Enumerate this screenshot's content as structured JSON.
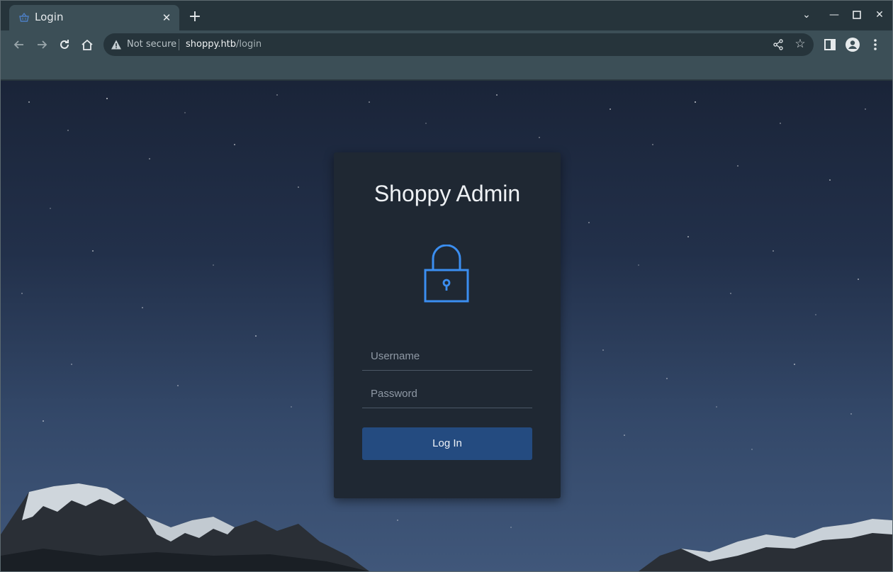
{
  "browser": {
    "tab": {
      "title": "Login",
      "favicon": "basket-icon"
    },
    "omnibox": {
      "security_label": "Not secure",
      "url_host": "shoppy.htb",
      "url_path": "/login"
    },
    "colors": {
      "accent": "#3b8ef0",
      "button": "#244b80",
      "card": "#1f2833"
    }
  },
  "login": {
    "title": "Shoppy Admin",
    "username_placeholder": "Username",
    "password_placeholder": "Password",
    "submit_label": "Log In",
    "icon": "lock-icon"
  }
}
